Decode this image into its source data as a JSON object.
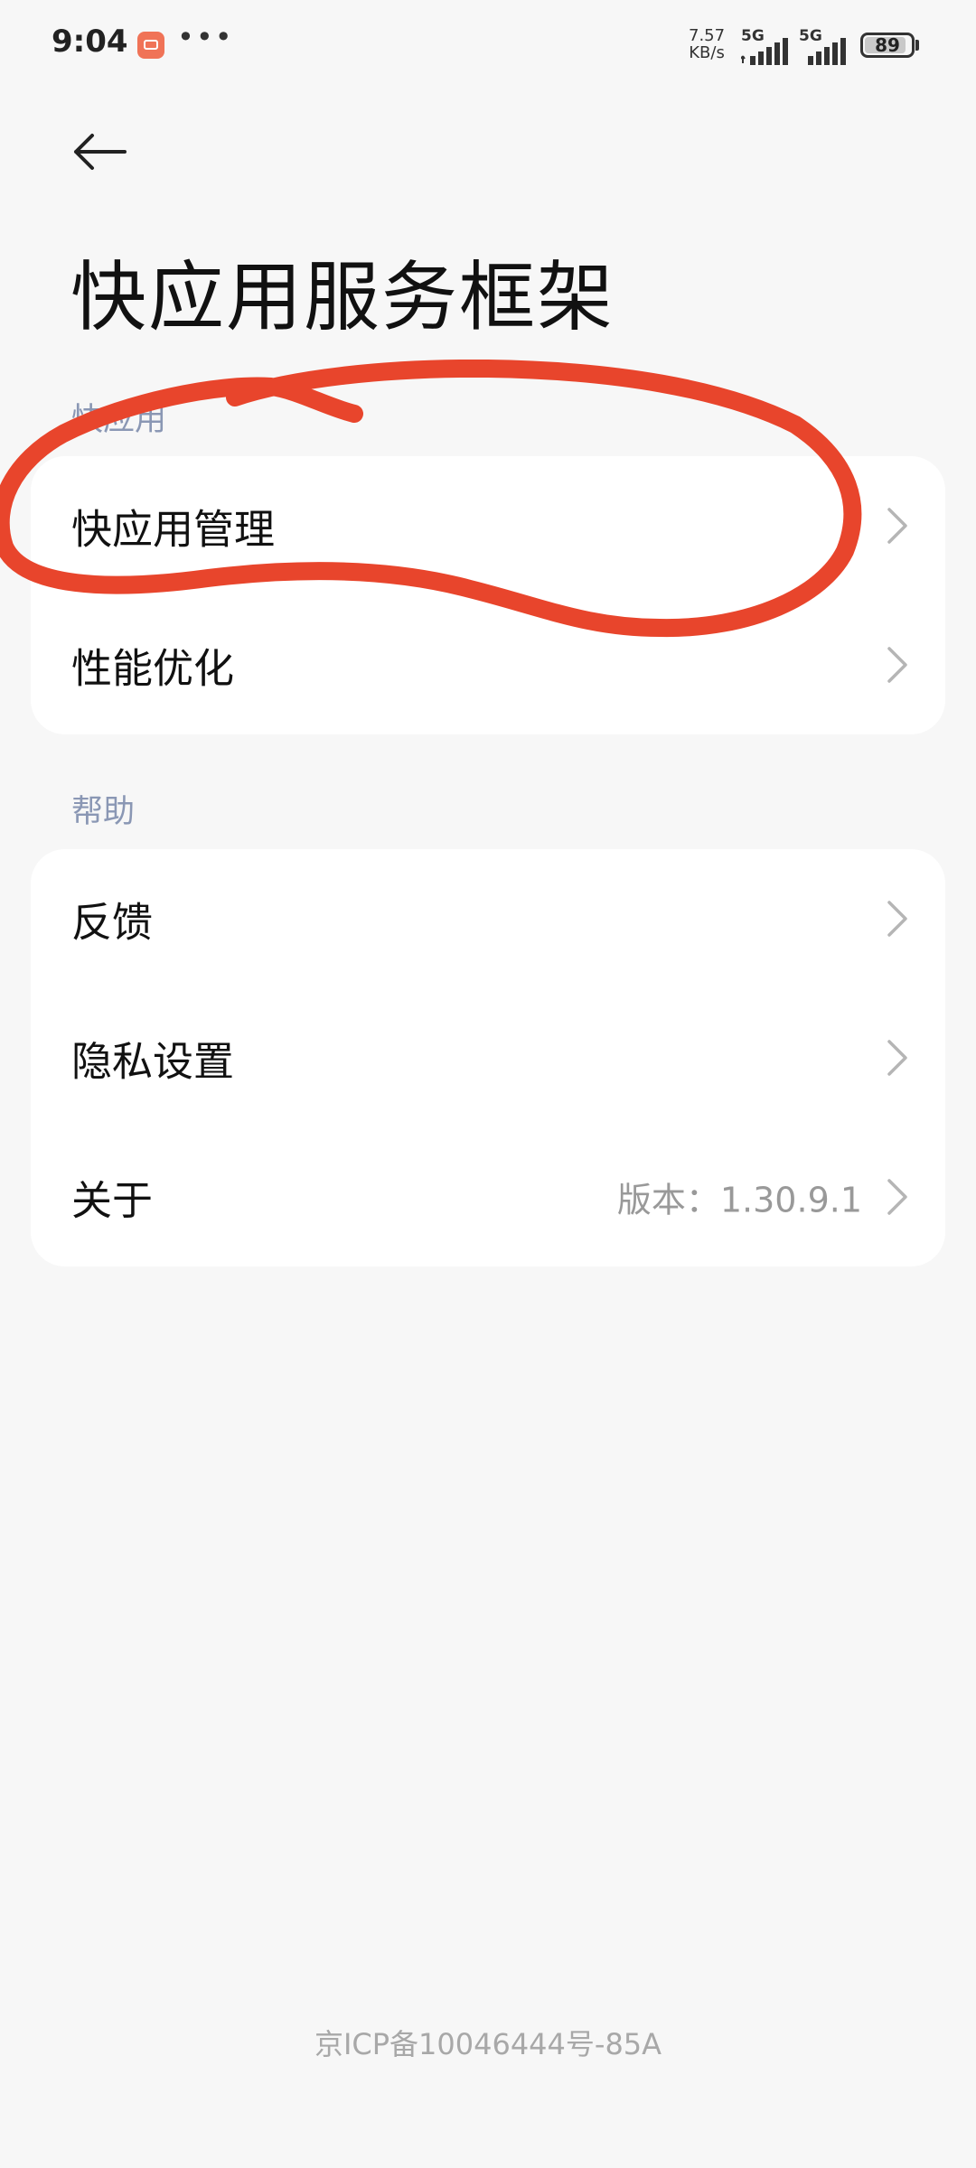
{
  "status_bar": {
    "time": "9:04",
    "more": "•••",
    "speed_value": "7.57",
    "speed_unit": "KB/s",
    "sim1": "5G",
    "sim2": "5G",
    "battery": "89",
    "battery_level": 0.89
  },
  "header": {
    "back_icon": "arrow-left-icon",
    "title": "快应用服务框架"
  },
  "sections": {
    "quick_app": {
      "header": "快应用",
      "items": [
        {
          "label": "快应用管理"
        },
        {
          "label": "性能优化"
        }
      ]
    },
    "help": {
      "header": "帮助",
      "items": [
        {
          "label": "反馈"
        },
        {
          "label": "隐私设置"
        },
        {
          "label": "关于",
          "value": "版本：1.30.9.1"
        }
      ]
    }
  },
  "footer": "京ICP备10046444号-85A",
  "colors": {
    "annotation_stroke": "#e8452c",
    "section_header": "#8a97b4",
    "background": "#f7f7f7"
  }
}
